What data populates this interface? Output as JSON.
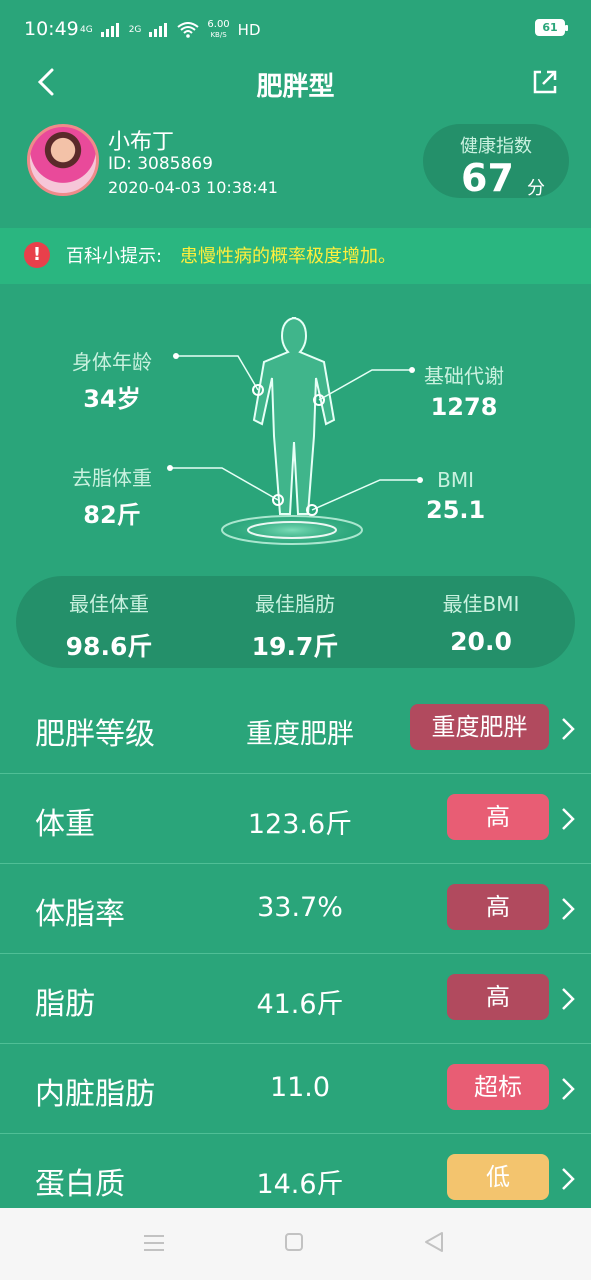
{
  "status": {
    "time": "10:49",
    "network_1": "4G",
    "network_2": "2G",
    "net_speed_value": "6.00",
    "net_speed_unit": "KB/S",
    "hd": "HD",
    "battery": "61"
  },
  "nav": {
    "title": "肥胖型"
  },
  "profile": {
    "name": "小布丁",
    "id": "ID: 3085869",
    "datetime": "2020-04-03 10:38:41",
    "score_label": "健康指数",
    "score_value": "67",
    "score_unit": "分"
  },
  "tip": {
    "label": "百科小提示:",
    "text": "患慢性病的概率极度增加。"
  },
  "body_metrics": {
    "age_label": "身体年龄",
    "age_value": "34岁",
    "bmr_label": "基础代谢",
    "bmr_value": "1278",
    "lean_label": "去脂体重",
    "lean_value": "82斤",
    "bmi_label": "BMI",
    "bmi_value": "25.1"
  },
  "best": {
    "weight_label": "最佳体重",
    "weight_value": "98.6斤",
    "fat_label": "最佳脂肪",
    "fat_value": "19.7斤",
    "bmi_label": "最佳BMI",
    "bmi_value": "20.0"
  },
  "rows": [
    {
      "label": "肥胖等级",
      "value": "重度肥胖",
      "badge": "重度肥胖",
      "badge_color": "#b14a5e"
    },
    {
      "label": "体重",
      "value": "123.6斤",
      "badge": "高",
      "badge_color": "#e85d74"
    },
    {
      "label": "体脂率",
      "value": "33.7%",
      "badge": "高",
      "badge_color": "#b14a5e"
    },
    {
      "label": "脂肪",
      "value": "41.6斤",
      "badge": "高",
      "badge_color": "#b14a5e"
    },
    {
      "label": "内脏脂肪",
      "value": "11.0",
      "badge": "超标",
      "badge_color": "#e85d74"
    },
    {
      "label": "蛋白质",
      "value": "14.6斤",
      "badge": "低",
      "badge_color": "#f3c46e"
    }
  ],
  "colors": {
    "background": "#2aa57a",
    "panel": "#24906a",
    "tip_bar": "#2ab680",
    "tip_text": "#ffef3d",
    "alert": "#e8404b"
  }
}
